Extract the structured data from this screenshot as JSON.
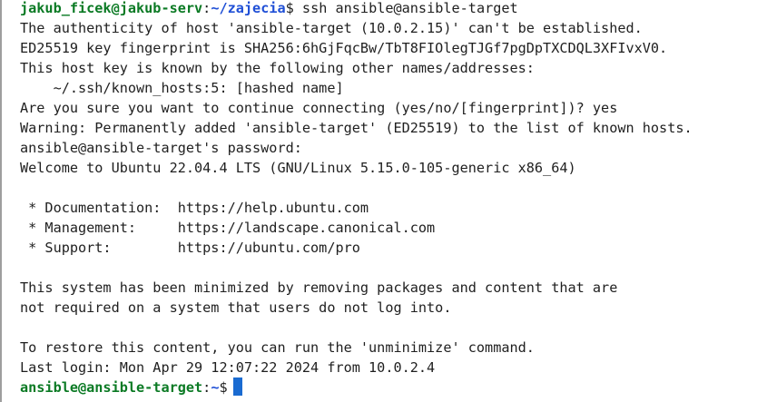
{
  "terminal": {
    "prompt1": {
      "user_host": "jakub_ficek@jakub-serv",
      "separator": ":",
      "path": "~/zajecia",
      "symbol": "$",
      "command": " ssh ansible@ansible-target"
    },
    "output": [
      "The authenticity of host 'ansible-target (10.0.2.15)' can't be established.",
      "ED25519 key fingerprint is SHA256:6hGjFqcBw/TbT8FIOlegTJGf7pgDpTXCDQL3XFIvxV0.",
      "This host key is known by the following other names/addresses:",
      "    ~/.ssh/known_hosts:5: [hashed name]",
      "Are you sure you want to continue connecting (yes/no/[fingerprint])? yes",
      "Warning: Permanently added 'ansible-target' (ED25519) to the list of known hosts.",
      "ansible@ansible-target's password:",
      "Welcome to Ubuntu 22.04.4 LTS (GNU/Linux 5.15.0-105-generic x86_64)",
      "",
      " * Documentation:  https://help.ubuntu.com",
      " * Management:     https://landscape.canonical.com",
      " * Support:        https://ubuntu.com/pro",
      "",
      "This system has been minimized by removing packages and content that are",
      "not required on a system that users do not log into.",
      "",
      "To restore this content, you can run the 'unminimize' command.",
      "Last login: Mon Apr 29 12:07:22 2024 from 10.0.2.4"
    ],
    "prompt2": {
      "user_host": "ansible@ansible-target",
      "separator": ":",
      "path": "~",
      "symbol": "$"
    },
    "colors": {
      "background": "#ffffff",
      "text": "#1f1f1f",
      "prompt_user": "#0b7a24",
      "prompt_path": "#1f4fd6",
      "cursor": "#1a6bd1"
    }
  }
}
